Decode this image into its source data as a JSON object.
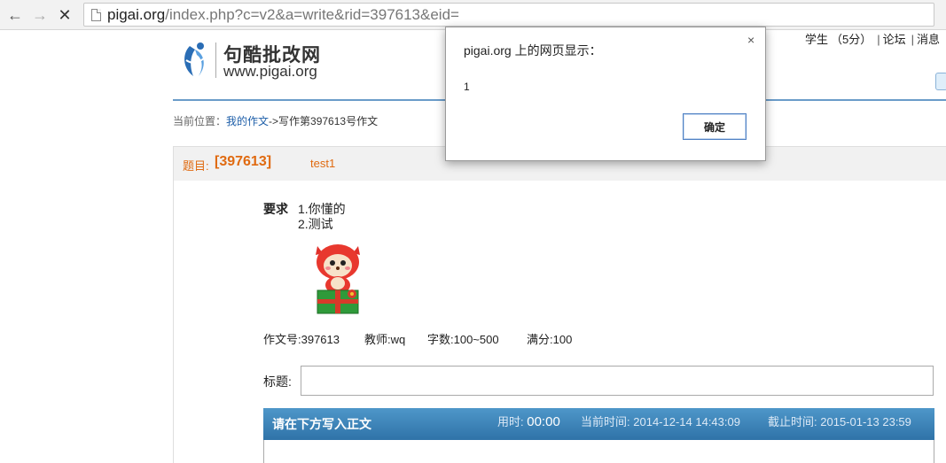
{
  "browser": {
    "url_host": "pigai.org",
    "url_rest": "/index.php?c=v2&a=write&rid=397613&eid="
  },
  "header": {
    "logo_cn": "句酷批改网",
    "logo_en": "www.pigai.org",
    "user_links": [
      "学生",
      "（5分）",
      "论坛",
      "消息"
    ]
  },
  "breadcrumb": {
    "prefix": "当前位置：",
    "link": "我的作文",
    "current": "->写作第397613号作文"
  },
  "assignment": {
    "title_label": "题目:",
    "id_text": "[397613]",
    "name": "test1",
    "requirement_label": "要求",
    "requirements": [
      "1.你懂的",
      "2.测试"
    ],
    "meta": {
      "number": "作文号:397613",
      "teacher": "教师:wq",
      "words": "字数:100~500",
      "full_score": "满分:100"
    }
  },
  "form": {
    "heading_label": "标题:",
    "heading_value": ""
  },
  "write_bar": {
    "title": "请在下方写入正文",
    "used_label": "用时:",
    "used_value": "00:00",
    "now_label": "当前时间:",
    "now_value": "2014-12-14 14:43:09",
    "deadline_label": "截止时间:",
    "deadline_value": "2015-01-13 23:59"
  },
  "dialog": {
    "title": "pigai.org 上的网页显示：",
    "message": "1",
    "ok_label": "确定",
    "close_icon": "×"
  },
  "colors": {
    "accent_orange": "#e06a10",
    "link_blue": "#1d5ea8",
    "bar_blue": "#3a82b8"
  }
}
